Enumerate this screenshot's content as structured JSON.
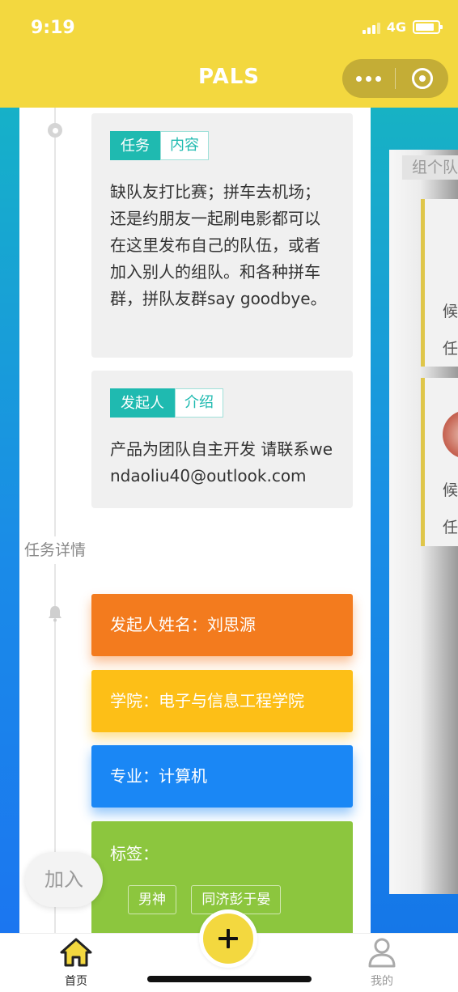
{
  "status_bar": {
    "time": "9:19",
    "network": "4G"
  },
  "nav": {
    "title": "PALS"
  },
  "right_panel": {
    "tab_label": "组个队",
    "card1_line1": "候",
    "card1_line2": "任",
    "card2_line1": "候",
    "card2_line2": "任"
  },
  "intro_card": {
    "tag_solid": "任务",
    "tag_outline": "内容",
    "text": "缺队友打比赛；拼车去机场；还是约朋友一起刷电影都可以在这里发布自己的队伍，或者加入别人的组队。和各种拼车群，拼队友群say goodbye。"
  },
  "initiator_card": {
    "tag_solid": "发起人",
    "tag_outline": "介绍",
    "text": "产品为团队自主开发 请联系wendaoliu40@outlook.com"
  },
  "timeline": {
    "section_label": "任务详情"
  },
  "detail_cards": {
    "name": "发起人姓名：刘思源",
    "college": "学院：电子与信息工程学院",
    "major": "专业：计算机",
    "tags_label": "标签：",
    "tags": [
      "男神",
      "同济彭于晏"
    ]
  },
  "join_button": {
    "label": "加入"
  },
  "tabbar": {
    "home_label": "首页",
    "me_label": "我的"
  },
  "colors": {
    "brand_yellow": "#f3d83f",
    "teal": "#1fbab0",
    "orange": "#f37b1e",
    "amber": "#fdbf17",
    "blue": "#1a87f5",
    "green": "#8cc63e"
  }
}
